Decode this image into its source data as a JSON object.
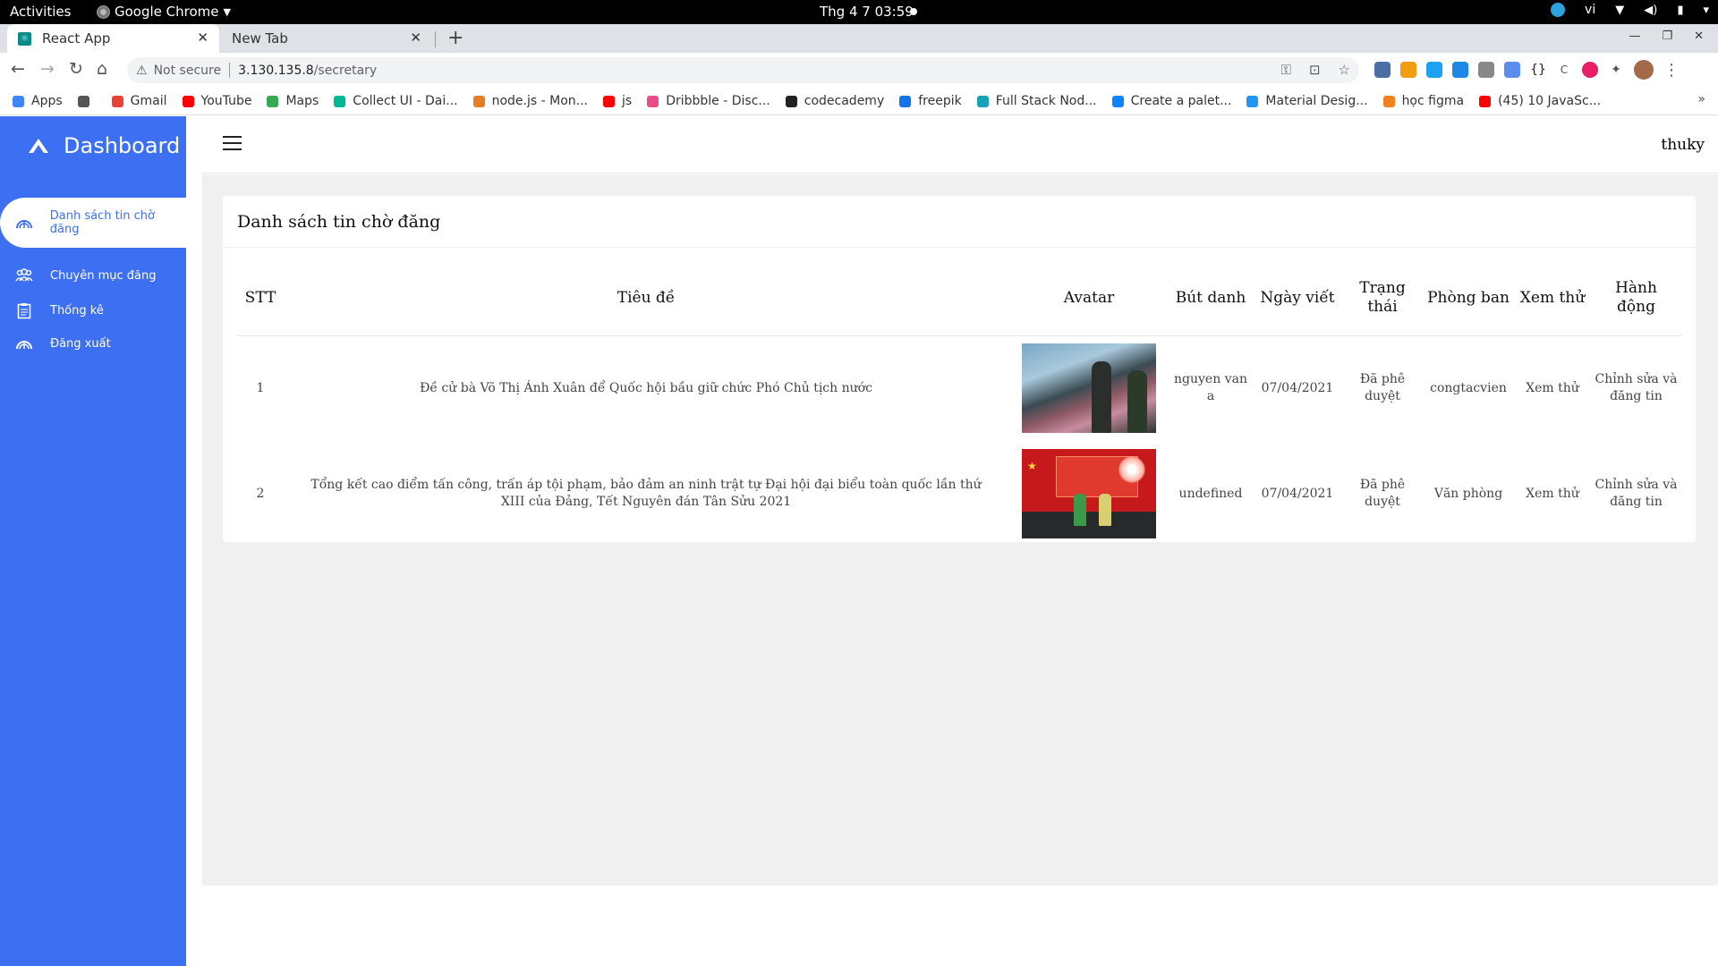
{
  "os": {
    "activities": "Activities",
    "app_name": "Google Chrome",
    "clock": "Thg 4 7  03:59",
    "lang": "vi"
  },
  "browser": {
    "tabs": [
      {
        "title": "React App",
        "active": true
      },
      {
        "title": "New Tab",
        "active": false
      }
    ],
    "url_warning": "Not secure",
    "url_host": "3.130.135.8",
    "url_path": "/secretary",
    "bookmarks": [
      {
        "label": "Apps",
        "color": "#4285f4"
      },
      {
        "label": "",
        "color": "#555555"
      },
      {
        "label": "Gmail",
        "color": "#ea4335"
      },
      {
        "label": "YouTube",
        "color": "#ff0000"
      },
      {
        "label": "Maps",
        "color": "#34a853"
      },
      {
        "label": "Collect UI - Dai...",
        "color": "#00b894"
      },
      {
        "label": "node.js - Mon...",
        "color": "#e67e22"
      },
      {
        "label": "js",
        "color": "#ff0000"
      },
      {
        "label": "Dribbble - Disc...",
        "color": "#ea4c89"
      },
      {
        "label": "codecademy",
        "color": "#222222"
      },
      {
        "label": "freepik",
        "color": "#1273eb"
      },
      {
        "label": "Full Stack Nod...",
        "color": "#17a2b8"
      },
      {
        "label": "Create a palet...",
        "color": "#0a84ff"
      },
      {
        "label": "Material Desig...",
        "color": "#2196f3"
      },
      {
        "label": "học figma",
        "color": "#f4811f"
      },
      {
        "label": "(45) 10 JavaSc...",
        "color": "#ff0000"
      }
    ]
  },
  "app": {
    "brand": "Dashboard",
    "accent": "#3c6ff2",
    "menu": [
      {
        "label": "Danh sách tin chờ đăng",
        "active": true,
        "icon": "dashboard-gauge-icon"
      },
      {
        "label": "Chuyên mục đăng",
        "active": false,
        "icon": "users-group-icon"
      },
      {
        "label": "Thống kê",
        "active": false,
        "icon": "clipboard-icon"
      },
      {
        "label": "Đăng xuất",
        "active": false,
        "icon": "logout-gauge-icon"
      }
    ],
    "username": "thuky",
    "card_title": "Danh sách tin chờ đăng",
    "table": {
      "headers": [
        "STT",
        "Tiêu đề",
        "Avatar",
        "Bút danh",
        "Ngày viết",
        "Trạng thái",
        "Phòng ban",
        "Xem thử",
        "Hành động"
      ],
      "rows": [
        {
          "stt": "1",
          "title": "Đề cử bà Võ Thị Ánh Xuân để Quốc hội bầu giữ chức Phó Chủ tịch nước",
          "author": "nguyen van a",
          "date": "07/04/2021",
          "status": "Đã phê duyệt",
          "department": "congtacvien",
          "preview": "Xem thử",
          "action": "Chỉnh sửa và đăng tin"
        },
        {
          "stt": "2",
          "title": "Tổng kết cao điểm tấn công, trấn áp tội phạm, bảo đảm an ninh trật tự Đại hội đại biểu toàn quốc lần thứ XIII của Đảng, Tết Nguyên đán Tân Sửu 2021",
          "author": "undefined",
          "date": "07/04/2021",
          "status": "Đã phê duyệt",
          "department": "Văn phòng",
          "preview": "Xem thử",
          "action": "Chỉnh sửa và đăng tin"
        }
      ]
    }
  }
}
